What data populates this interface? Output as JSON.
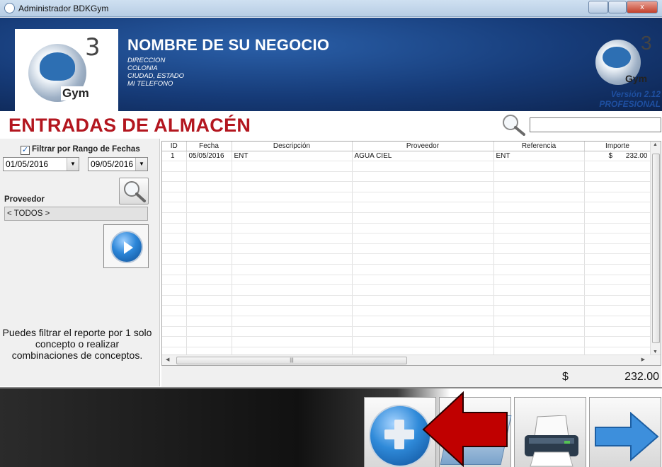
{
  "window": {
    "title": "Administrador BDKGym",
    "close_label": "x"
  },
  "header": {
    "business_name": "NOMBRE DE SU NEGOCIO",
    "address_lines": [
      "DIRECCION",
      "COLONIA",
      "CIUDAD, ESTADO",
      "MI TELEFONO"
    ],
    "logo_text": "Gym",
    "logo_mark": "3",
    "version": "Versión 2.12",
    "edition": "PROFESIONAL"
  },
  "page_title": "ENTRADAS DE ALMACÉN",
  "search": {
    "value": ""
  },
  "filters": {
    "date_range_label": "Filtrar por Rango de Fechas",
    "date_range_checked": true,
    "date_from": "01/05/2016",
    "date_to": "09/05/2016",
    "supplier_label": "Proveedor",
    "supplier_value": "< TODOS >",
    "hint": "Puedes filtrar el reporte por 1 solo concepto o realizar combinaciones de conceptos."
  },
  "table": {
    "columns": [
      "ID",
      "Fecha",
      "Descripción",
      "Proveedor",
      "Referencia",
      "Importe"
    ],
    "rows": [
      {
        "id": "1",
        "fecha": "05/05/2016",
        "descripcion": "ENT",
        "proveedor": "AGUA CIEL",
        "referencia": "ENT",
        "importe_symbol": "$",
        "importe": "232.00"
      }
    ],
    "empty_rows": 19
  },
  "total": {
    "symbol": "$",
    "value": "232.00"
  },
  "toolbar": {
    "buttons": [
      "add",
      "documents",
      "print",
      "next"
    ]
  },
  "colors": {
    "accent_red": "#b3161f",
    "header_blue": "#163b78",
    "version_blue": "#1e4fa0",
    "arrow_red": "#c00000"
  }
}
